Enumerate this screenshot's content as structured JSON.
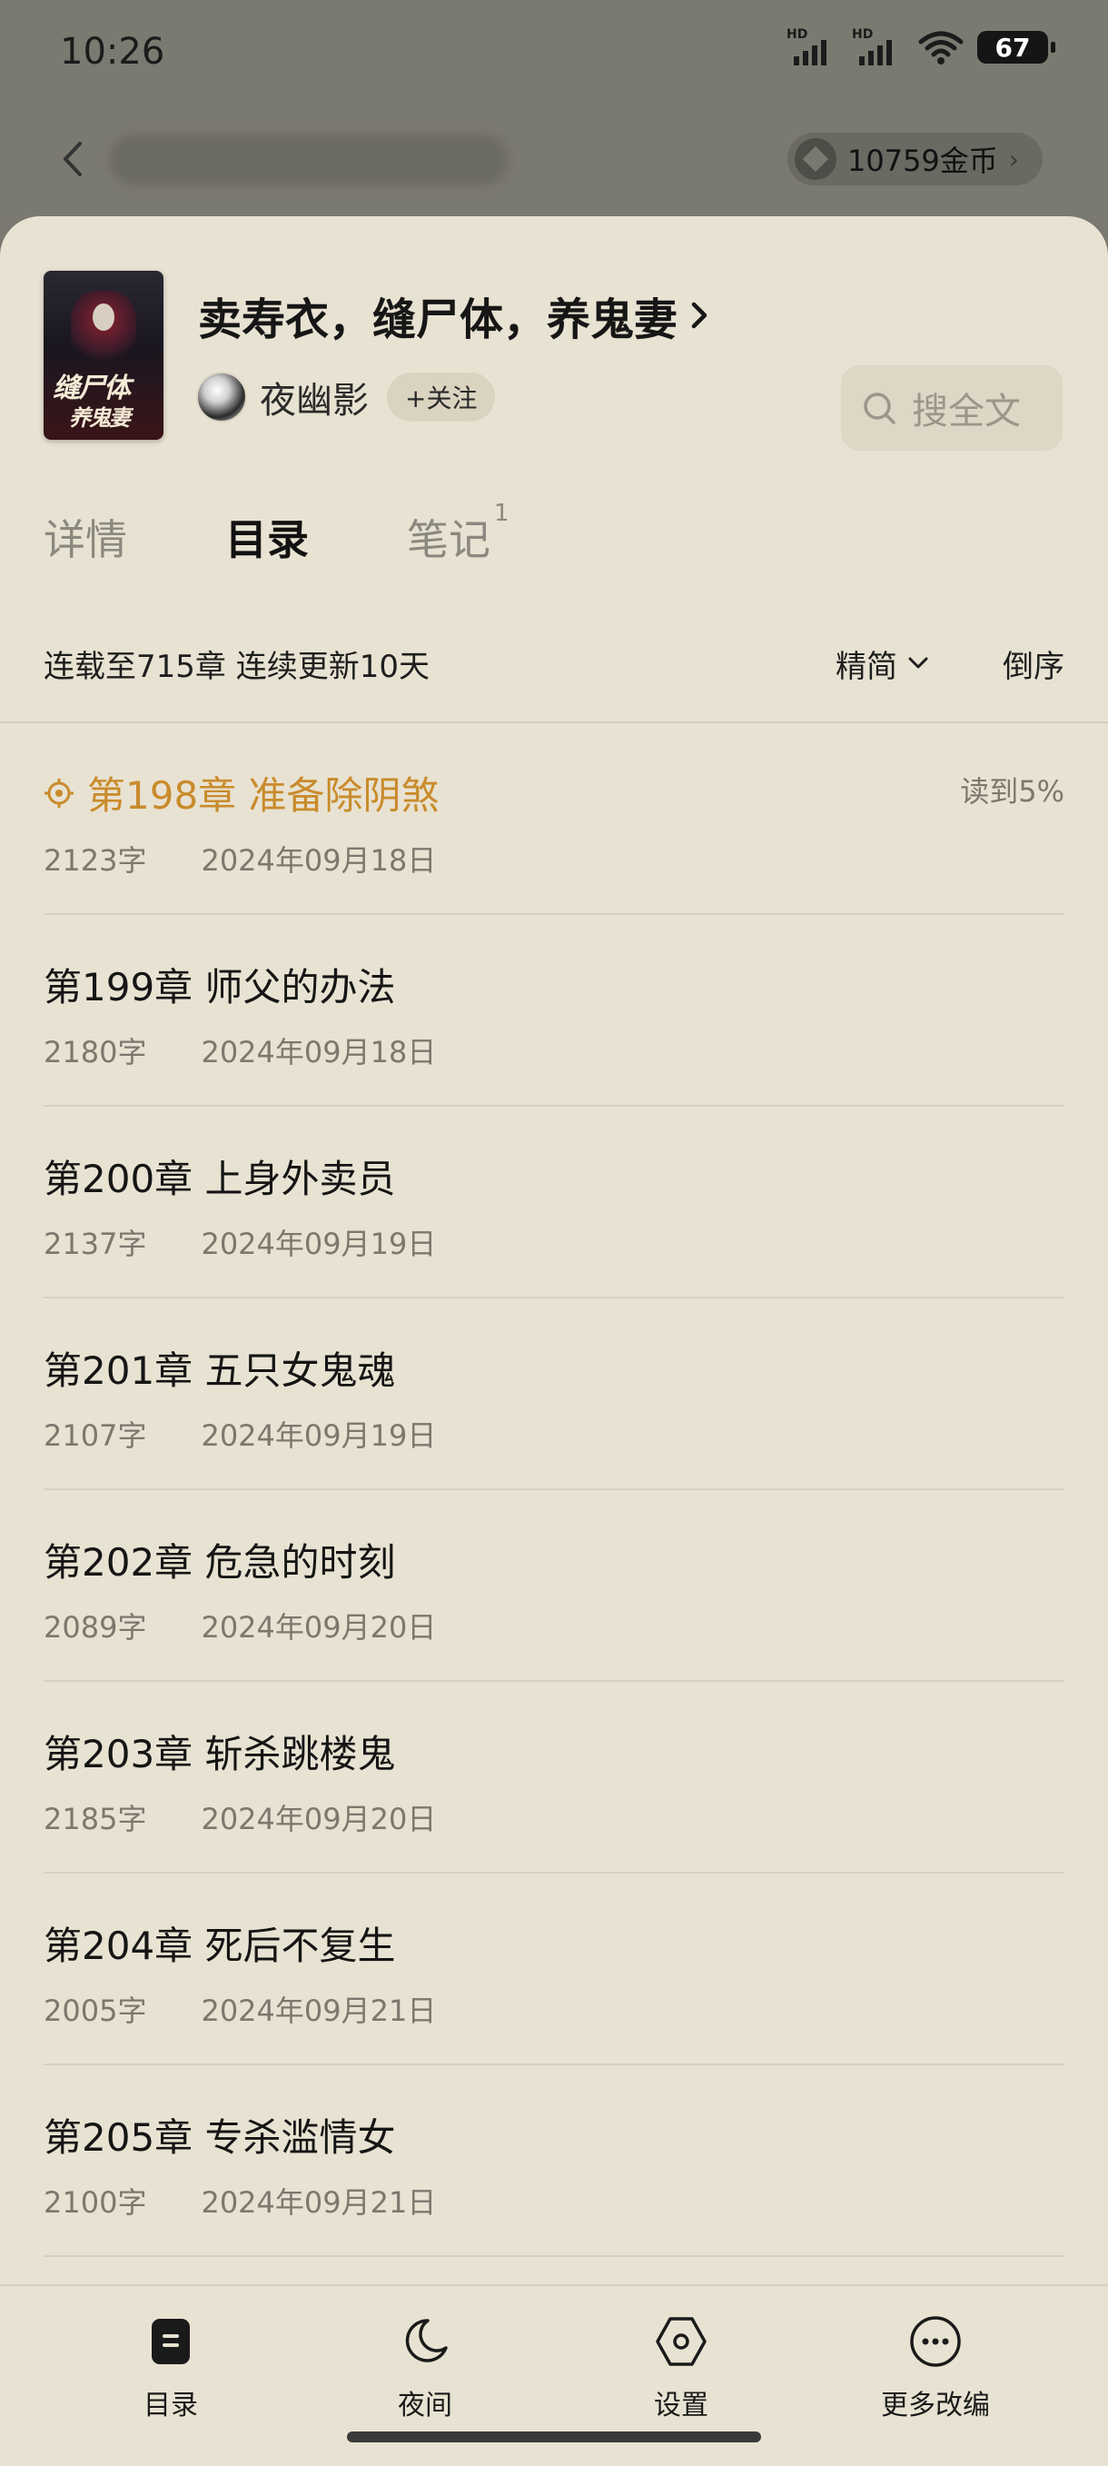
{
  "status_bar": {
    "time": "10:26",
    "battery": "67",
    "sim1": "HD",
    "sim2": "HD",
    "wifi_sub": "6"
  },
  "top_bar": {
    "coins": "10759金币",
    "icons": [
      "back-arrow-icon",
      "coin-icon",
      "chevron-right-icon"
    ]
  },
  "book": {
    "title": "卖寿衣，缝尸体，养鬼妻",
    "cover_text_line1": "缝尸体",
    "cover_text_line2": "养鬼妻",
    "author": "夜幽影",
    "follow_label": "+关注",
    "search_placeholder": "搜全文"
  },
  "tabs": [
    {
      "label": "详情",
      "badge": ""
    },
    {
      "label": "目录",
      "badge": "",
      "active": true
    },
    {
      "label": "笔记",
      "badge": "1"
    }
  ],
  "info": {
    "serial_status": "连载至715章 连续更新10天",
    "script_option": "精简",
    "order_label": "倒序"
  },
  "chapters": [
    {
      "title": "第198章 准备除阴煞",
      "words": "2123字",
      "date": "2024年09月18日",
      "progress": "读到5%",
      "current": true
    },
    {
      "title": "第199章 师父的办法",
      "words": "2180字",
      "date": "2024年09月18日"
    },
    {
      "title": "第200章 上身外卖员",
      "words": "2137字",
      "date": "2024年09月19日"
    },
    {
      "title": "第201章 五只女鬼魂",
      "words": "2107字",
      "date": "2024年09月19日"
    },
    {
      "title": "第202章 危急的时刻",
      "words": "2089字",
      "date": "2024年09月20日"
    },
    {
      "title": "第203章 斩杀跳楼鬼",
      "words": "2185字",
      "date": "2024年09月20日"
    },
    {
      "title": "第204章 死后不复生",
      "words": "2005字",
      "date": "2024年09月21日"
    },
    {
      "title": "第205章 专杀滥情女",
      "words": "2100字",
      "date": "2024年09月21日"
    }
  ],
  "bottom_nav": [
    {
      "label": "目录",
      "icon": "toc-icon"
    },
    {
      "label": "夜间",
      "icon": "moon-icon"
    },
    {
      "label": "设置",
      "icon": "settings-hexagon-icon"
    },
    {
      "label": "更多改编",
      "icon": "more-dots-icon"
    }
  ],
  "colors": {
    "sheet_bg": "#e8e2d2",
    "accent": "#c98b2b",
    "backdrop": "#7b7a71"
  }
}
